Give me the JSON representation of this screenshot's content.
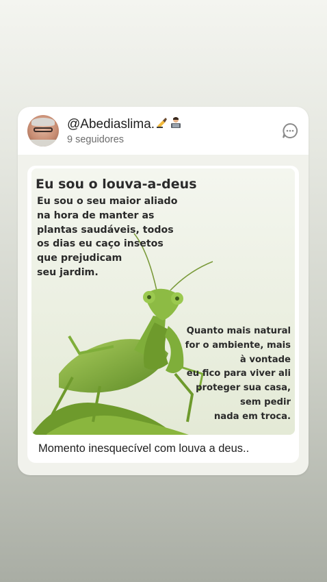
{
  "post": {
    "username": "@Abediaslima.",
    "username_emojis": [
      "writing-hand-emoji",
      "technologist-emoji"
    ],
    "followers": "9 seguidores",
    "caption": "Momento inesquecível com louva a deus.."
  },
  "poster": {
    "title": "Eu sou o louva-a-deus",
    "left_lines": [
      "Eu sou o seu maior aliado",
      "na hora de manter as",
      "plantas saudáveis, todos",
      "os dias eu caço insetos",
      "que prejudicam",
      "seu jardim."
    ],
    "right_lines": [
      "Quanto mais natural",
      "for o ambiente, mais",
      "à vontade",
      "eu fico para viver ali",
      "proteger sua casa,",
      "sem pedir",
      "nada em troca."
    ]
  },
  "icons": {
    "comment": "comment-bubble-icon",
    "avatar": "profile-photo"
  },
  "colors": {
    "card_bg": "#f1f2ec",
    "mantis_green": "#7fae3a",
    "text_dark": "#2a2a2a"
  }
}
